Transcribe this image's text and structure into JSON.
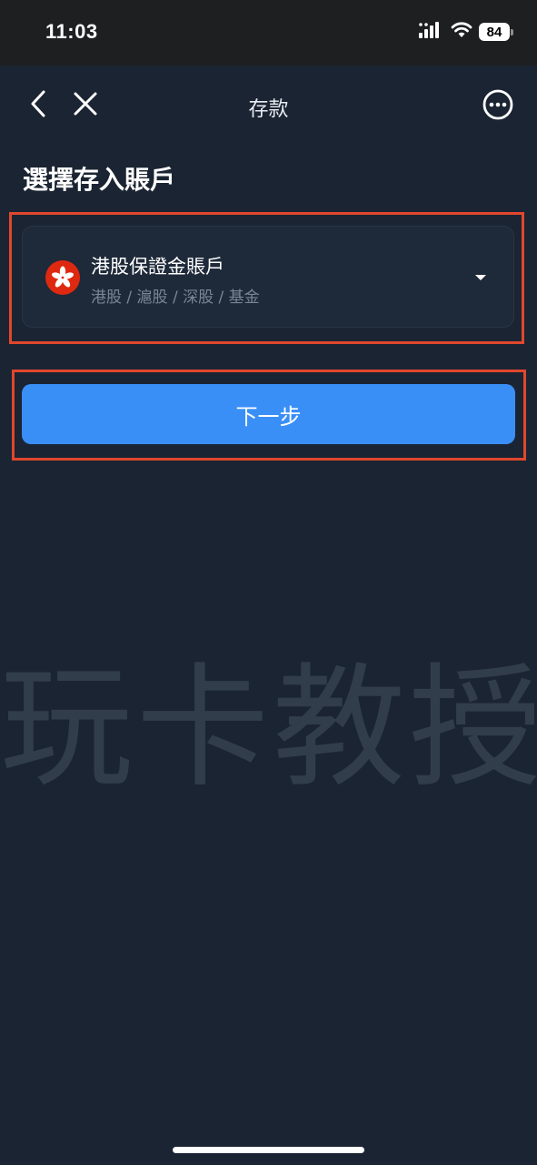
{
  "status_bar": {
    "time": "11:03",
    "battery_level": "84",
    "icons": [
      "cellular-signal-icon",
      "wifi-icon",
      "battery-icon"
    ]
  },
  "nav": {
    "title": "存款",
    "back_icon": "chevron-left-icon",
    "close_icon": "close-icon",
    "more_icon": "more-options-icon"
  },
  "section": {
    "title": "選擇存入賬戶"
  },
  "account": {
    "name": "港股保證金賬戶",
    "markets": "港股 / 滬股 / 深股 / 基金",
    "flag_icon": "hong-kong-flag-icon",
    "dropdown_icon": "caret-down-icon"
  },
  "actions": {
    "next_label": "下一步"
  },
  "watermark": {
    "text": "玩卡教授"
  },
  "colors": {
    "background": "#1b2432",
    "card": "#1e2939",
    "accent": "#3a8ff7",
    "highlight": "#e0472d",
    "flag_red": "#de2910"
  }
}
